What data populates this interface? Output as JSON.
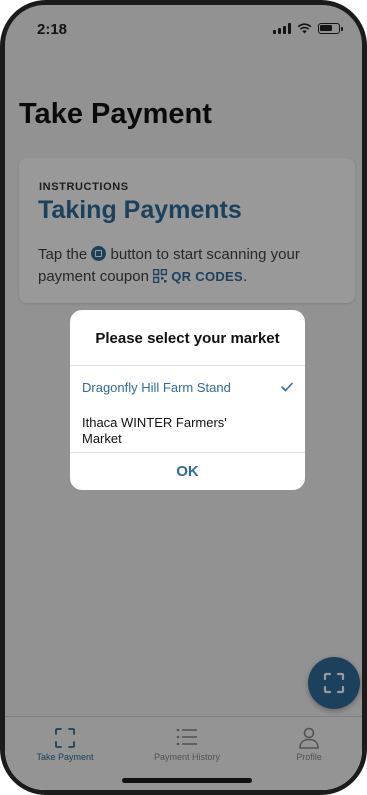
{
  "status_bar": {
    "time": "2:18"
  },
  "page": {
    "title": "Take Payment"
  },
  "instructions_card": {
    "eyebrow": "INSTRUCTIONS",
    "heading": "Taking Payments",
    "text_before_icon": "Tap the ",
    "text_after_icon": " button to start scanning your payment coupon ",
    "qr_label": "QR CODES",
    "text_end": "."
  },
  "dialog": {
    "title": "Please select your market",
    "options": [
      {
        "label": "Dragonfly Hill Farm Stand",
        "selected": true
      },
      {
        "label": "Ithaca WINTER Farmers' Market",
        "selected": false
      }
    ],
    "ok_label": "OK"
  },
  "tabs": [
    {
      "label": "Take Payment",
      "icon": "scan-icon",
      "active": true
    },
    {
      "label": "Payment History",
      "icon": "list-icon",
      "active": false
    },
    {
      "label": "Profile",
      "icon": "profile-icon",
      "active": false
    }
  ],
  "fab": {
    "icon": "scan-icon"
  },
  "colors": {
    "accent": "#2e6d99",
    "overlay": "rgba(0,0,0,0.4)"
  }
}
